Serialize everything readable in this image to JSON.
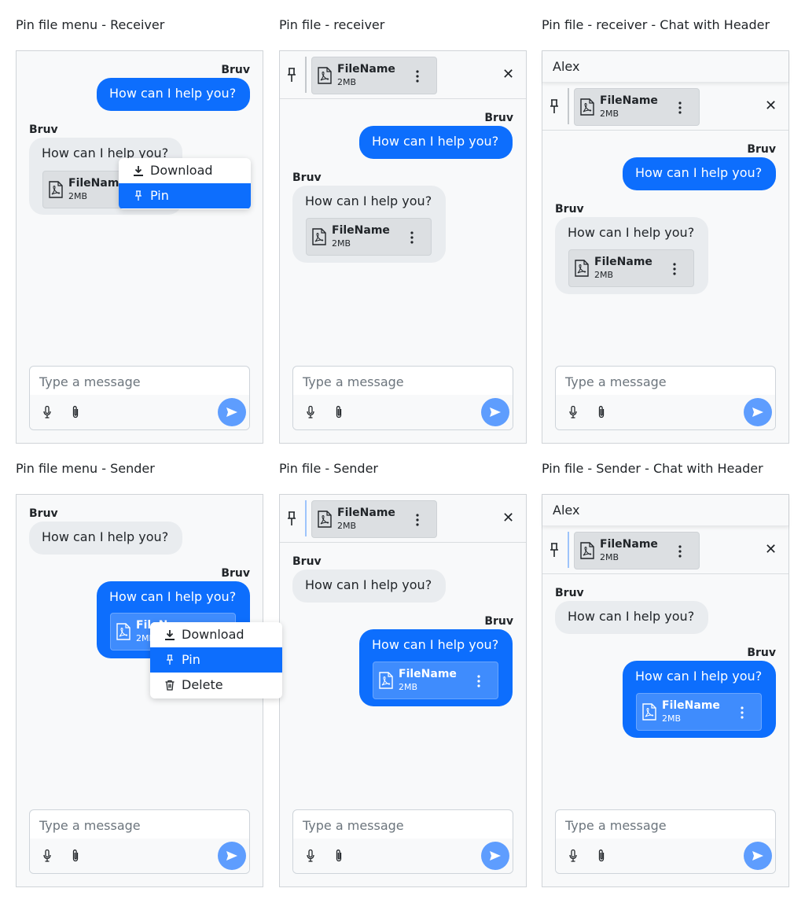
{
  "panels": [
    {
      "title": "Pin file menu - Receiver"
    },
    {
      "title": "Pin file - receiver"
    },
    {
      "title": "Pin file - receiver - Chat with Header"
    },
    {
      "title": "Pin file menu - Sender"
    },
    {
      "title": "Pin file - Sender"
    },
    {
      "title": "Pin file - Sender - Chat with Header"
    }
  ],
  "chat": {
    "header_name": "Alex",
    "sender": "Bruv",
    "message": "How can I help you?",
    "file_name": "FileName",
    "file_size": "2MB",
    "composer_placeholder": "Type a message"
  },
  "menu": {
    "download": "Download",
    "pin": "Pin",
    "delete": "Delete"
  },
  "icons": {
    "pin": "pin-icon",
    "close": "close-icon",
    "file": "pdf-file-icon",
    "more": "kebab-icon",
    "download": "download-icon",
    "delete": "trash-icon",
    "mic": "microphone-icon",
    "attach": "paperclip-icon",
    "send": "send-icon"
  },
  "colors": {
    "accent": "#0d6efd",
    "active_menu": "#0d6efd",
    "incoming_bubble": "#e9ecef",
    "send_button": "#5e9dfe",
    "frame_bg": "#f8f9fa"
  }
}
